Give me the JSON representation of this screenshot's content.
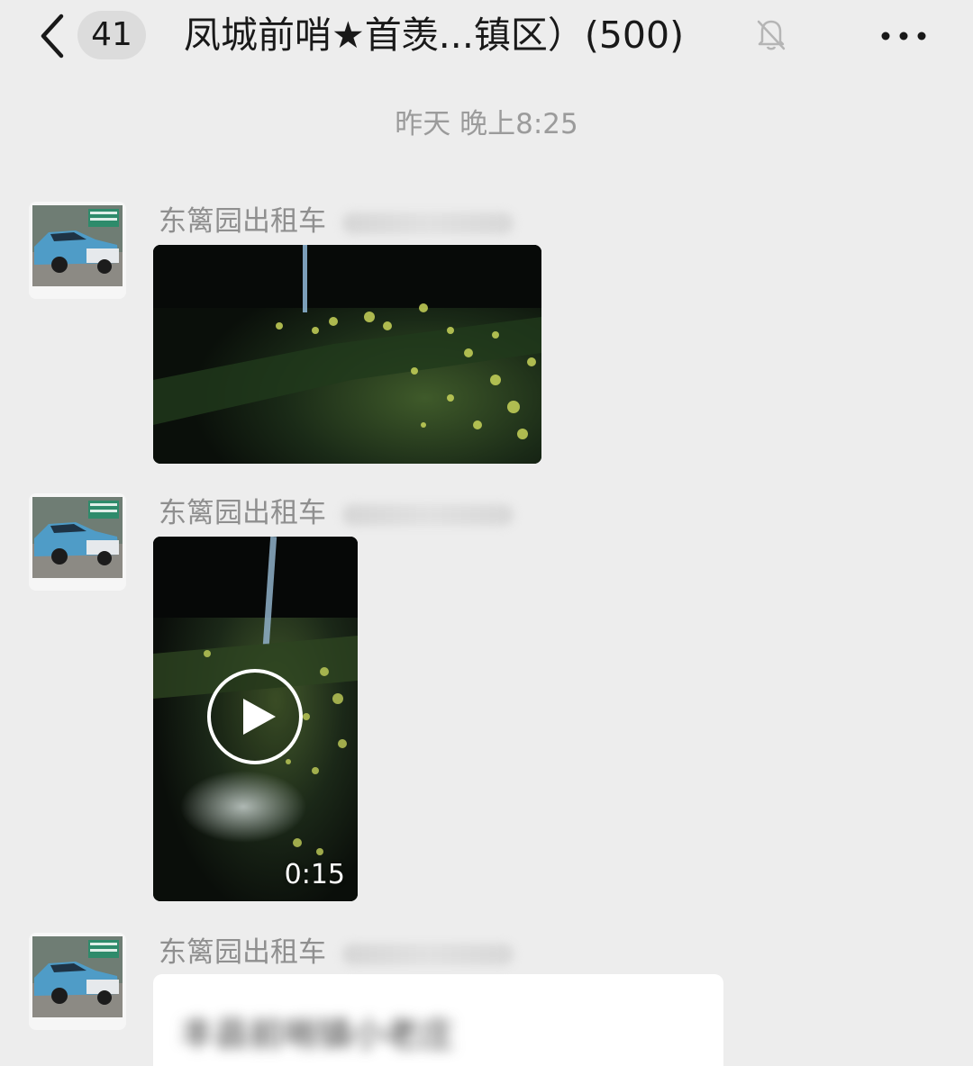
{
  "header": {
    "unread_count": "41",
    "title": "凤城前哨★首羡...镇区）(500)",
    "icons": {
      "back": "chevron-left-icon",
      "mute": "bell-off-icon",
      "more": "more-dots-icon"
    }
  },
  "timestamp": "昨天 晚上8:25",
  "messages": [
    {
      "sender": "东篱园出租车",
      "type": "image",
      "avatar": "taxi-car-avatar"
    },
    {
      "sender": "东篱园出租车",
      "type": "video",
      "duration": "0:15",
      "avatar": "taxi-car-avatar"
    },
    {
      "sender": "东篱园出租车",
      "type": "text",
      "text": "丰县前哨镇小老庄",
      "avatar": "taxi-car-avatar"
    }
  ],
  "colors": {
    "background": "#ededed",
    "badge": "#dcdcdc",
    "bubble": "#ffffff",
    "secondary_text": "#8f8f8f"
  }
}
